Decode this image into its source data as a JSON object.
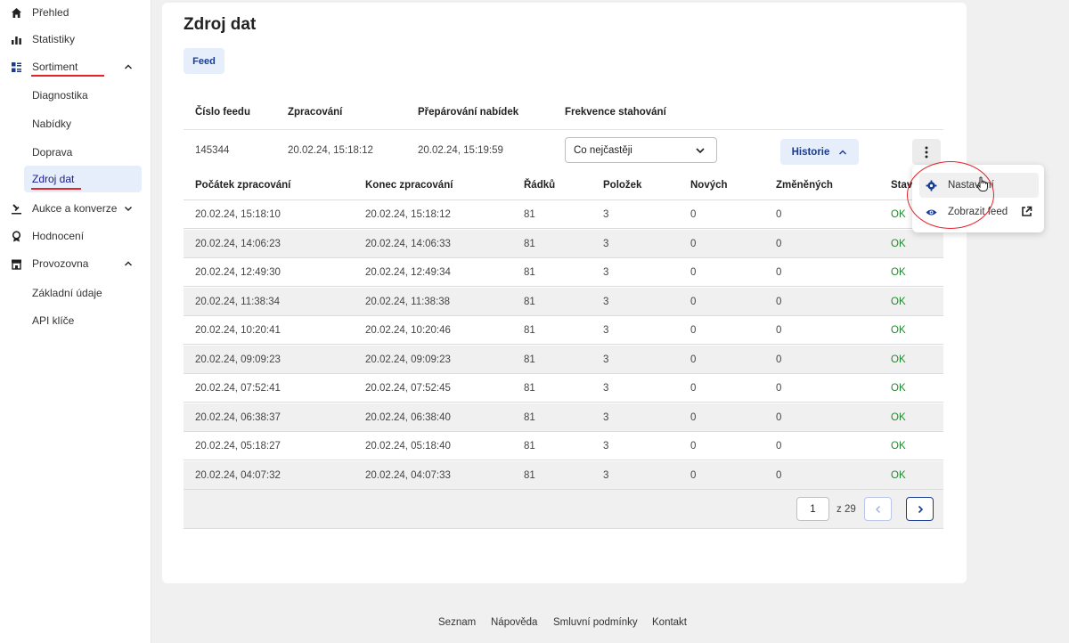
{
  "sidebar": {
    "items": [
      {
        "label": "Přehled",
        "icon": "home-icon"
      },
      {
        "label": "Statistiky",
        "icon": "bar-chart-icon"
      },
      {
        "label": "Sortiment",
        "icon": "grid-list-icon",
        "expanded": true
      },
      {
        "label": "Aukce a konverze",
        "icon": "gavel-icon",
        "expanded": false
      },
      {
        "label": "Hodnocení",
        "icon": "award-icon"
      },
      {
        "label": "Provozovna",
        "icon": "store-icon",
        "expanded": true
      }
    ],
    "sortiment_sub": [
      "Diagnostika",
      "Nabídky",
      "Doprava",
      "Zdroj dat"
    ],
    "provozovna_sub": [
      "Základní údaje",
      "API klíče"
    ],
    "active_sub": "Zdroj dat",
    "accent_color": "#e4222a"
  },
  "main": {
    "title": "Zdroj dat",
    "tab": "Feed",
    "feed_table": {
      "headers": [
        "Číslo feedu",
        "Zpracování",
        "Přepárování nabídek",
        "Frekvence stahování"
      ],
      "row": {
        "id": "145344",
        "processing": "20.02.24, 15:18:12",
        "reparsing": "20.02.24, 15:19:59",
        "frequency": "Co nejčastěji"
      },
      "history_button": "Historie"
    },
    "history": {
      "headers": [
        "Počátek zpracování",
        "Konec zpracování",
        "Řádků",
        "Položek",
        "Nových",
        "Změněných",
        "Stav"
      ],
      "rows": [
        [
          "20.02.24, 15:18:10",
          "20.02.24, 15:18:12",
          "81",
          "3",
          "0",
          "0",
          "OK"
        ],
        [
          "20.02.24, 14:06:23",
          "20.02.24, 14:06:33",
          "81",
          "3",
          "0",
          "0",
          "OK"
        ],
        [
          "20.02.24, 12:49:30",
          "20.02.24, 12:49:34",
          "81",
          "3",
          "0",
          "0",
          "OK"
        ],
        [
          "20.02.24, 11:38:34",
          "20.02.24, 11:38:38",
          "81",
          "3",
          "0",
          "0",
          "OK"
        ],
        [
          "20.02.24, 10:20:41",
          "20.02.24, 10:20:46",
          "81",
          "3",
          "0",
          "0",
          "OK"
        ],
        [
          "20.02.24, 09:09:23",
          "20.02.24, 09:09:23",
          "81",
          "3",
          "0",
          "0",
          "OK"
        ],
        [
          "20.02.24, 07:52:41",
          "20.02.24, 07:52:45",
          "81",
          "3",
          "0",
          "0",
          "OK"
        ],
        [
          "20.02.24, 06:38:37",
          "20.02.24, 06:38:40",
          "81",
          "3",
          "0",
          "0",
          "OK"
        ],
        [
          "20.02.24, 05:18:27",
          "20.02.24, 05:18:40",
          "81",
          "3",
          "0",
          "0",
          "OK"
        ],
        [
          "20.02.24, 04:07:32",
          "20.02.24, 04:07:33",
          "81",
          "3",
          "0",
          "0",
          "OK"
        ]
      ],
      "status_color": "#1f8a2e"
    },
    "pagination": {
      "current": "1",
      "of_label": "z 29"
    }
  },
  "popup_menu": {
    "items": [
      {
        "label": "Nastavení",
        "icon": "gear-icon"
      },
      {
        "label": "Zobrazit feed",
        "icon": "eye-icon",
        "trailing_icon": "external-link-icon"
      }
    ]
  },
  "footer": {
    "links": [
      "Seznam",
      "Nápověda",
      "Smluvní podmínky",
      "Kontakt"
    ]
  }
}
